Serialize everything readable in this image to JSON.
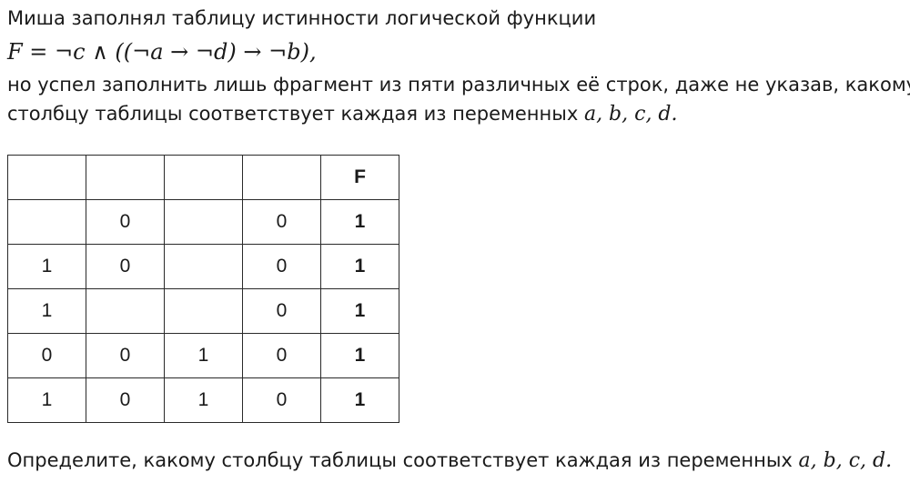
{
  "problem": {
    "intro": "Миша заполнял таблицу истинности логической функции",
    "formula": "F = ¬c ∧ ((¬a → ¬d) → ¬b),",
    "line2": "но успел заполнить лишь фрагмент из пяти различных её строк, даже не указав, какому",
    "line3_text": "столбцу таблицы соответствует каждая из переменных ",
    "line3_vars": "a, b, c, d.",
    "question_text": "Определите, какому столбцу таблицы соответствует каждая из переменных ",
    "question_vars": "a, b, c, d."
  },
  "table": {
    "header": [
      "",
      "",
      "",
      "",
      "F"
    ],
    "rows": [
      [
        "",
        "0",
        "",
        "0",
        "1"
      ],
      [
        "1",
        "0",
        "",
        "0",
        "1"
      ],
      [
        "1",
        "",
        "",
        "0",
        "1"
      ],
      [
        "0",
        "0",
        "1",
        "0",
        "1"
      ],
      [
        "1",
        "0",
        "1",
        "0",
        "1"
      ]
    ]
  }
}
